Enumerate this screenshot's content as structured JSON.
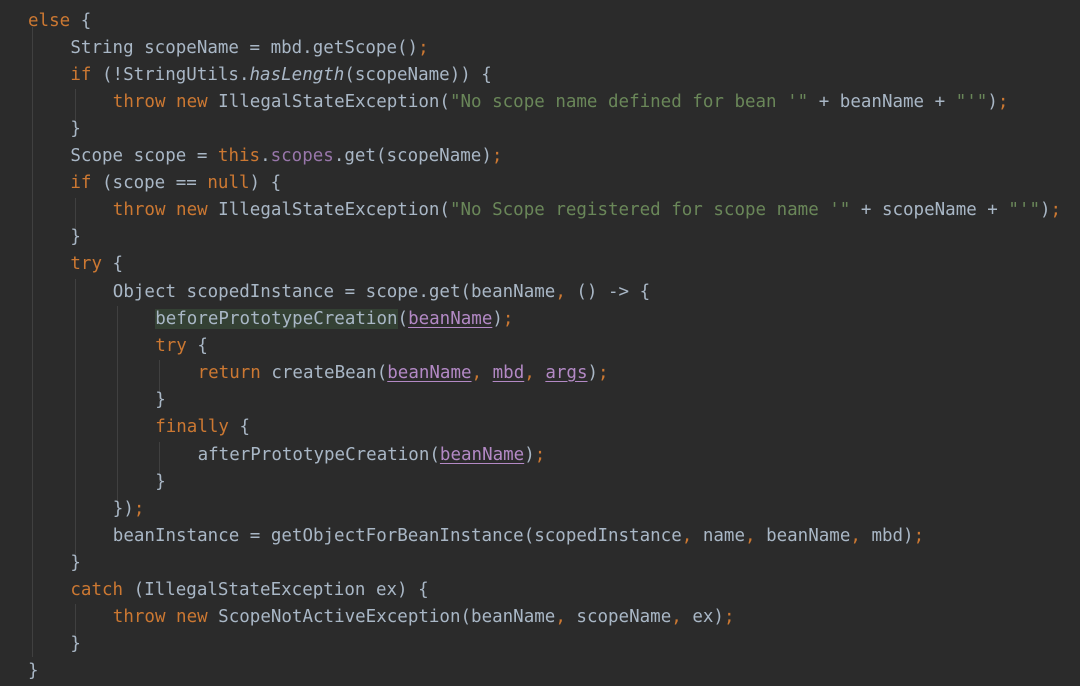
{
  "code": {
    "lines": [
      "else {",
      "String scopeName = mbd.getScope();",
      "if (!StringUtils.hasLength(scopeName)) {",
      "throw new IllegalStateException(\"No scope name defined for bean '\" + beanName + \"'\");",
      "}",
      "Scope scope = this.scopes.get(scopeName);",
      "if (scope == null) {",
      "throw new IllegalStateException(\"No Scope registered for scope name '\" + scopeName + \"'\");",
      "}",
      "try {",
      "Object scopedInstance = scope.get(beanName, () -> {",
      "beforePrototypeCreation(beanName);",
      "try {",
      "return createBean(beanName, mbd, args);",
      "}",
      "finally {",
      "afterPrototypeCreation(beanName);",
      "}",
      "});",
      "beanInstance = getObjectForBeanInstance(scopedInstance, name, beanName, mbd);",
      "}",
      "catch (IllegalStateException ex) {",
      "throw new ScopeNotActiveException(beanName, scopeName, ex);",
      "}",
      "}"
    ]
  },
  "colors": {
    "background": "#2b2b2b",
    "keyword": "#cc7832",
    "string": "#6a8759",
    "identifier": "#a9b7c6",
    "field": "#9876aa",
    "captured_variable": "#b389c5",
    "selection_highlight": "#344134"
  }
}
